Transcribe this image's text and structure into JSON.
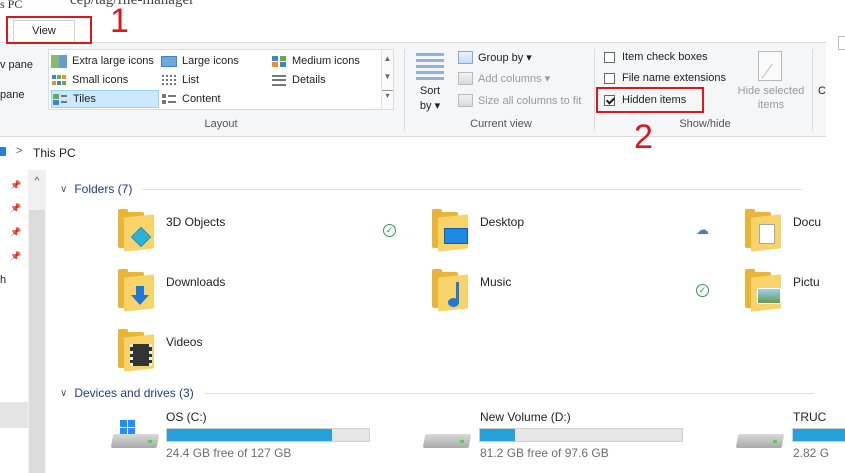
{
  "window": {
    "crumb": "s PC",
    "headline": "cep/tag/file-manager"
  },
  "ribbon": {
    "view_tab": "View",
    "left_pane": [
      "v pane",
      "pane"
    ],
    "layout": {
      "label": "Layout",
      "items": [
        {
          "label": "Extra large icons",
          "selected": false
        },
        {
          "label": "Large icons",
          "selected": false
        },
        {
          "label": "Medium icons",
          "selected": false
        },
        {
          "label": "Small icons",
          "selected": false
        },
        {
          "label": "List",
          "selected": false
        },
        {
          "label": "Details",
          "selected": false
        },
        {
          "label": "Tiles",
          "selected": true
        },
        {
          "label": "Content",
          "selected": false
        }
      ],
      "scroll_up": "▲",
      "scroll_mid": "▼",
      "scroll_more": "▾"
    },
    "current_view": {
      "label": "Current view",
      "sort": "Sort",
      "sort_by": "by ▾",
      "group_by": "Group by ▾",
      "add_columns": "Add columns ▾",
      "size_all": "Size all columns to fit"
    },
    "show_hide": {
      "label": "Show/hide",
      "item_check_boxes": {
        "label": "Item check boxes",
        "checked": false
      },
      "file_name_extensions": {
        "label": "File name extensions",
        "checked": false
      },
      "hidden_items": {
        "label": "Hidden items",
        "checked": true
      },
      "hide_selected_1": "Hide selected",
      "hide_selected_2": "items",
      "options_fragment": "C"
    }
  },
  "annotations": {
    "step1": "1",
    "step2": "2",
    "color": "#e0161d"
  },
  "address": {
    "arrow": ">",
    "path": "This PC"
  },
  "nav": {
    "up": "^",
    "fragment_h": "h",
    "pin": "📌"
  },
  "folders": {
    "heading": "Folders (7)",
    "items": [
      {
        "name": "3D Objects",
        "status": "✓"
      },
      {
        "name": "Desktop",
        "status": "☁"
      },
      {
        "name": "Docu",
        "status": ""
      },
      {
        "name": "Downloads",
        "status": ""
      },
      {
        "name": "Music",
        "status": "✓"
      },
      {
        "name": "Pictu",
        "status": ""
      },
      {
        "name": "Videos",
        "status": ""
      }
    ]
  },
  "drives": {
    "heading": "Devices and drives (3)",
    "items": [
      {
        "name": "OS (C:)",
        "free": "24.4 GB free of 127 GB",
        "used_fraction": 0.81
      },
      {
        "name": "New Volume (D:)",
        "free": "81.2 GB free of 97.6 GB",
        "used_fraction": 0.17
      },
      {
        "name": "TRUC",
        "free": "2.82 G",
        "used_fraction": 0.9
      }
    ]
  },
  "colors": {
    "accent": "#26a0da",
    "link": "#1f3c88",
    "folder": "#e8b537",
    "selection": "#cce8ff"
  }
}
